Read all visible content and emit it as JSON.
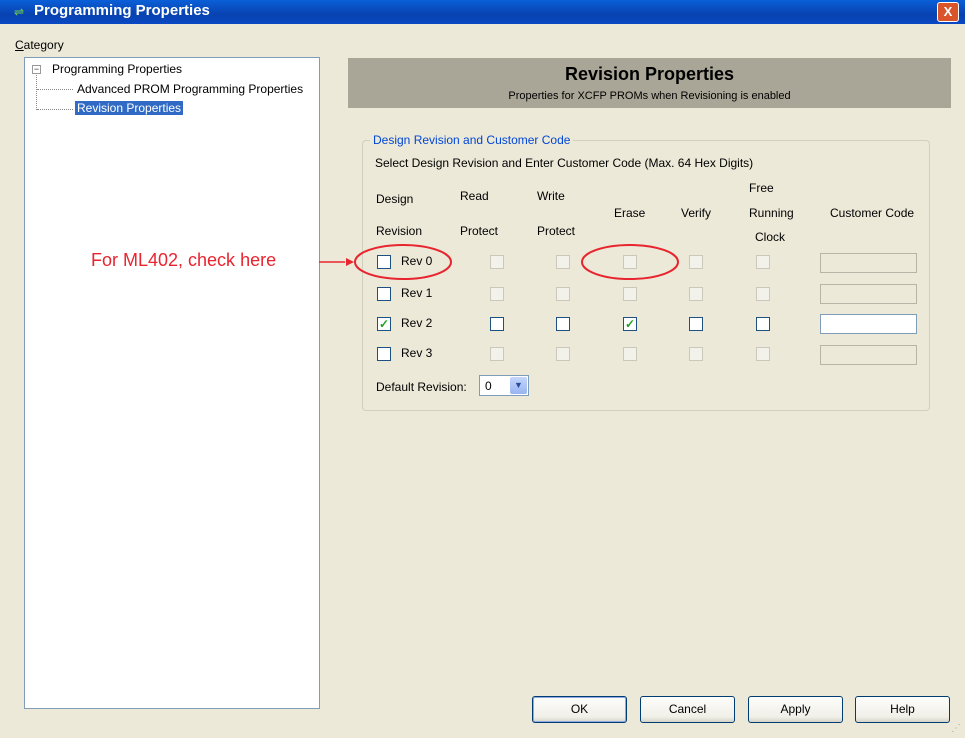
{
  "window": {
    "title": "Programming Properties",
    "close_label": "X"
  },
  "category": {
    "label_first": "C",
    "label_rest": "ategory"
  },
  "tree": {
    "root_label": "Programming Properties",
    "children": [
      {
        "label": "Advanced PROM Programming Properties",
        "selected": false
      },
      {
        "label": "Revision Properties",
        "selected": true
      }
    ]
  },
  "header": {
    "title": "Revision Properties",
    "subtitle": "Properties for XCFP PROMs when Revisioning is enabled"
  },
  "group": {
    "title": "Design Revision and Customer Code",
    "instruction": "Select Design Revision and Enter Customer Code (Max. 64 Hex Digits)",
    "columns": {
      "design_1": "Design",
      "design_2": "Revision",
      "read_1": "Read",
      "read_2": "Protect",
      "write_1": "Write",
      "write_2": "Protect",
      "erase": "Erase",
      "verify": "Verify",
      "free_1": "Free",
      "free_2": "Running",
      "free_3": "Clock",
      "customer_code": "Customer Code"
    },
    "rows": [
      {
        "label": "Rev 0",
        "checked": false,
        "enabled": false,
        "read": false,
        "write": false,
        "erase": false,
        "verify": false,
        "free": false,
        "code": ""
      },
      {
        "label": "Rev 1",
        "checked": false,
        "enabled": false,
        "read": false,
        "write": false,
        "erase": false,
        "verify": false,
        "free": false,
        "code": ""
      },
      {
        "label": "Rev 2",
        "checked": true,
        "enabled": true,
        "read": false,
        "write": false,
        "erase": true,
        "verify": false,
        "free": false,
        "code": ""
      },
      {
        "label": "Rev 3",
        "checked": false,
        "enabled": false,
        "read": false,
        "write": false,
        "erase": false,
        "verify": false,
        "free": false,
        "code": ""
      }
    ],
    "default_revision_label": "Default Revision:",
    "default_revision_value": "0"
  },
  "annotation": {
    "text": "For ML402, check here",
    "color": "#e8242f"
  },
  "buttons": {
    "ok": "OK",
    "cancel": "Cancel",
    "apply": "Apply",
    "help": "Help"
  },
  "icons": {
    "title": "app-icon",
    "tree_expander": "minus-box-icon",
    "dropdown": "chevron-down-icon",
    "check": "checkmark-icon"
  }
}
